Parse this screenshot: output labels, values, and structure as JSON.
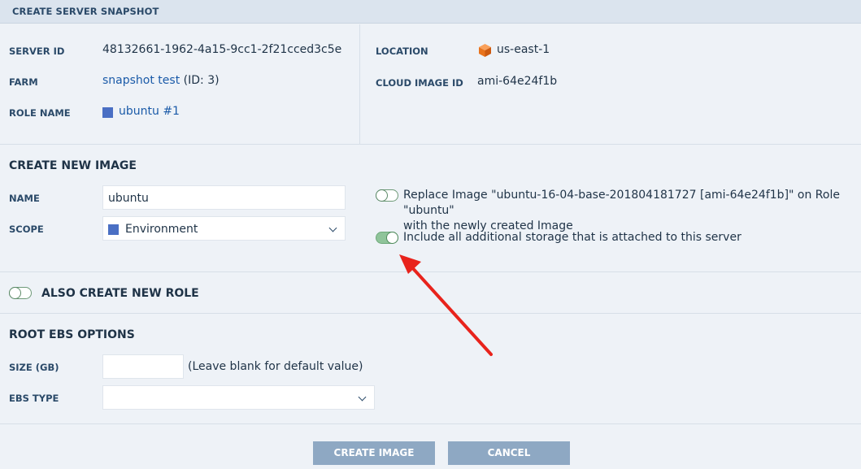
{
  "header": {
    "title": "CREATE SERVER SNAPSHOT"
  },
  "server_info": {
    "server_id_label": "SERVER ID",
    "server_id_value": "48132661-1962-4a15-9cc1-2f21cced3c5e",
    "farm_label": "FARM",
    "farm_link": "snapshot test",
    "farm_suffix": "(ID: 3)",
    "role_name_label": "ROLE NAME",
    "role_name_value": "ubuntu #1",
    "location_label": "LOCATION",
    "location_value": "us-east-1",
    "cloud_image_id_label": "CLOUD IMAGE ID",
    "cloud_image_id_value": "ami-64e24f1b",
    "role_color": "#4a6fc4",
    "location_icon": "aws-cube-icon"
  },
  "create_image": {
    "section_title": "CREATE NEW IMAGE",
    "name_label": "NAME",
    "name_value": "ubuntu",
    "scope_label": "SCOPE",
    "scope_value": "Environment",
    "replace_option": {
      "line1": "Replace Image \"ubuntu-16-04-base-201804181727 [ami-64e24f1b]\" on Role \"ubuntu\"",
      "line2": "with the newly created Image",
      "enabled": false
    },
    "storage_option": {
      "text": "Include all additional storage that is attached to this server",
      "enabled": true
    }
  },
  "new_role": {
    "label": "ALSO CREATE NEW ROLE",
    "enabled": false
  },
  "ebs": {
    "section_title": "ROOT EBS OPTIONS",
    "size_label": "SIZE (GB)",
    "size_value": "",
    "size_hint": "(Leave blank for default value)",
    "type_label": "EBS TYPE",
    "type_value": ""
  },
  "buttons": {
    "create": "CREATE IMAGE",
    "cancel": "CANCEL"
  },
  "colors": {
    "accent_link": "#1a5aa8",
    "button_bg": "#8ea8c3",
    "toggle_on": "#8fc49a",
    "annotation_arrow": "#e8231c"
  }
}
